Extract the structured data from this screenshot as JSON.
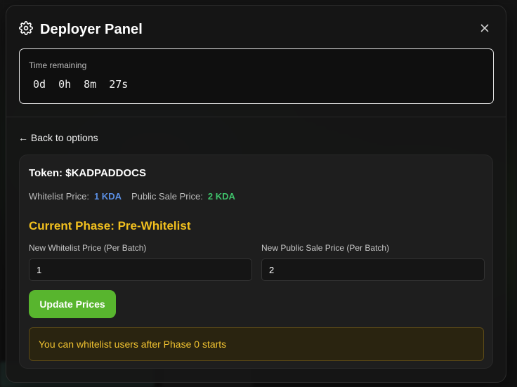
{
  "panel": {
    "title": "Deployer Panel",
    "icon": "gear-icon",
    "close_icon": "close-icon"
  },
  "timer": {
    "label": "Time remaining",
    "days": "0d",
    "hours": "0h",
    "minutes": "8m",
    "seconds": "27s"
  },
  "back_link": "← Back to options",
  "card": {
    "token_label": "Token: $KADPADDOCS",
    "whitelist_price_label": "Whitelist Price:",
    "whitelist_price_value": "1 KDA",
    "public_price_label": "Public Sale Price:",
    "public_price_value": "2 KDA",
    "phase": "Current Phase: Pre-Whitelist",
    "whitelist_field_label": "New Whitelist Price (Per Batch)",
    "whitelist_field_value": "1",
    "public_field_label": "New Public Sale Price (Per Batch)",
    "public_field_value": "2",
    "update_button": "Update Prices",
    "notice": "You can whitelist users after Phase 0 starts"
  },
  "colors": {
    "accent_green": "#58b52e",
    "phase_yellow": "#f2c01e",
    "whitelist_blue": "#5b8fe4",
    "public_green": "#3fc06a"
  }
}
